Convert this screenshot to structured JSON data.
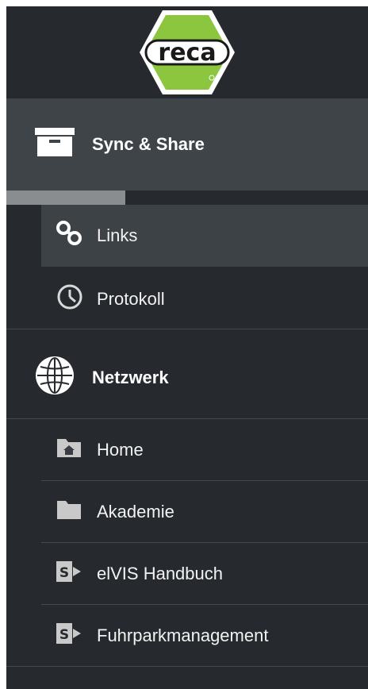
{
  "logo": {
    "text": "reca",
    "icon": "reca-hexagon-logo",
    "color": "#8cc63f"
  },
  "sections": {
    "sync": {
      "label": "Sync & Share",
      "icon": "archive-box-icon"
    },
    "network": {
      "label": "Netzwerk",
      "icon": "globe-icon"
    }
  },
  "progress": {
    "fraction": 0.33
  },
  "sync_items": [
    {
      "label": "Links",
      "icon": "link-icon",
      "active": true
    },
    {
      "label": "Protokoll",
      "icon": "clock-icon",
      "active": false
    }
  ],
  "network_items": [
    {
      "label": "Home",
      "icon": "folder-home-icon"
    },
    {
      "label": "Akademie",
      "icon": "folder-icon"
    },
    {
      "label": "elVIS Handbuch",
      "icon": "sharepoint-icon"
    },
    {
      "label": "Fuhrparkmanagement",
      "icon": "sharepoint-icon"
    }
  ],
  "colors": {
    "sidebar_bg": "#262a2e",
    "section_bg": "#3f4448",
    "active_bg": "#3d4246",
    "progress": "#8a8d90"
  }
}
